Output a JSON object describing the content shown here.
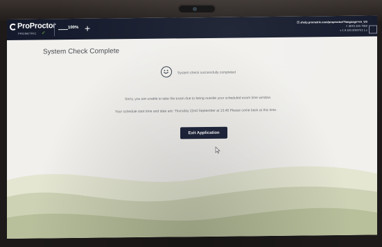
{
  "app": {
    "brand": "ProProctor",
    "brand_sub": "PROMETRIC",
    "zoom_out_label": "—",
    "zoom_level": "100%",
    "zoom_in_label": "+",
    "support_link": "ⓘ shelp.prometric.com/proproctor/?language=en_US",
    "support_phone": "↗ (800) 226-7869",
    "version": "v 1.9.120.2020721 1.c"
  },
  "main": {
    "title": "System Check Complete",
    "status_text": "System check successfully completed",
    "message_1": "Sorry, you are unable to take the exam due to being outside your scheduled exam time window.",
    "message_2": "Your schedule start time and date are: Thursday 22nd September at 13:45 Please come back at this time.",
    "exit_button_label": "Exit Application"
  },
  "icons": {
    "status": "smiley-face-icon",
    "logo": "proproctor-logo-icon",
    "cursor": "mouse-cursor-icon"
  },
  "colors": {
    "topbar": "#151b2c",
    "page_background": "#f1f0ed",
    "button": "#1a2138",
    "wave_light": "#e4e6d2",
    "wave_mid": "#cdd2b5",
    "wave_dark": "#b7bf9b"
  }
}
